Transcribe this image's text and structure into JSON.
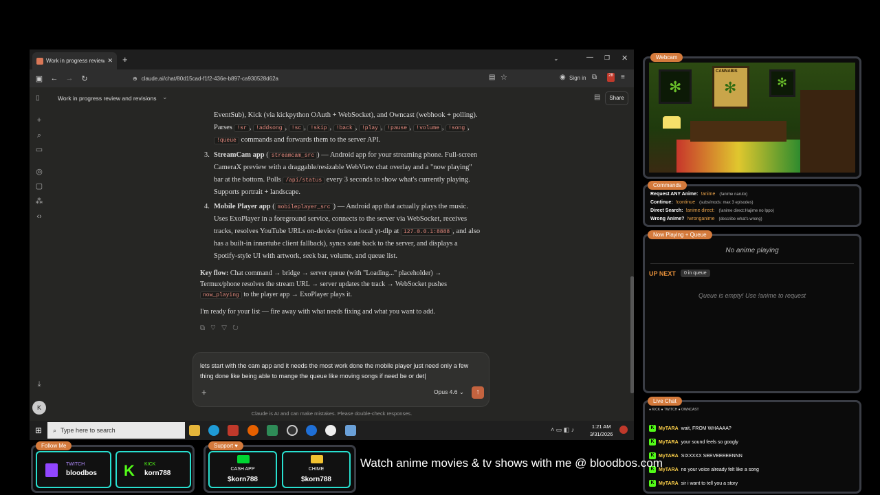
{
  "browser": {
    "tab_title": "Work in progress review and re",
    "url": "claude.ai/chat/80d15cad-f1f2-436e-b897-ca930528d62a",
    "sign_in": "Sign in",
    "ext_badge": "28"
  },
  "app": {
    "conversation_title": "Work in progress review and revisions",
    "share_label": "Share",
    "model": "Opus 4.6",
    "disclaimer": "Claude is AI and can make mistakes. Please double-check responses.",
    "composer_text": "lets start with the cam app and it needs the most work done the mobile player just need only a few thing done like being able to mange the queue like moving songs if need be or det|"
  },
  "message": {
    "p1_a": "EventSub), Kick (via kickpython OAuth + WebSocket), and Owncast (webhook + polling). Parses",
    "p1_codes": [
      "!sr",
      "!addsong",
      "!sc",
      "!skip",
      "!back",
      "!play",
      "!pause",
      "!volume",
      "!song",
      "!queue"
    ],
    "p1_b": "commands and forwards them to the server API.",
    "item3_num": "3.",
    "item3_title": "StreamCam app",
    "item3_code": "streamcam_src",
    "item3_a": "— Android app for your streaming phone. Full-screen CameraX preview with a draggable/resizable WebView chat overlay and a \"now playing\" bar at the bottom. Polls",
    "item3_code2": "/api/status",
    "item3_b": "every 3 seconds to show what's currently playing. Supports portrait + landscape.",
    "item4_num": "4.",
    "item4_title": "Mobile Player app",
    "item4_code": "mobileplayer_src",
    "item4_a": "— Android app that actually plays the music. Uses ExoPlayer in a foreground service, connects to the server via WebSocket, receives tracks, resolves YouTube URLs on-device (tries a local yt-dlp at",
    "item4_code2": "127.0.0.1:8888",
    "item4_b": ", and also has a built-in innertube client fallback), syncs state back to the server, and displays a Spotify-style UI with artwork, seek bar, volume, and queue list.",
    "keyflow_label": "Key flow:",
    "keyflow_a": "Chat command → bridge → server queue (with \"Loading...\" placeholder) → Termux/phone resolves the stream URL → server updates the track → WebSocket pushes",
    "keyflow_code": "now_playing",
    "keyflow_b": "to the player app → ExoPlayer plays it.",
    "closing": "I'm ready for your list — fire away with what needs fixing and what you want to add."
  },
  "taskbar": {
    "search_placeholder": "Type here to search",
    "time": "1:21 AM",
    "date": "3/31/2026"
  },
  "overlay": {
    "webcam_tag": "Webcam",
    "scene_sign": "CANNABIS",
    "commands_tag": "Commands",
    "commands": [
      {
        "label": "Request ANY Anime:",
        "cmd": "!anime",
        "desc": "(!anime naruto)"
      },
      {
        "label": "Continue:",
        "cmd": "!continue",
        "desc": "(subs/mods: max 3 episodes)"
      },
      {
        "label": "Direct Search:",
        "cmd": "!anime direct:",
        "desc": "(!anime direct:Hajime no Ippo)"
      },
      {
        "label": "Wrong Anime?",
        "cmd": "!wronganime",
        "desc": "(describe what's wrong)"
      }
    ],
    "now_tag": "Now Playing + Queue",
    "no_anime": "No anime playing",
    "up_next": "UP NEXT",
    "queue_count": "0 in queue",
    "queue_empty": "Queue is empty! Use !anime to request",
    "chat_tag": "Live Chat",
    "chat_platforms": "● KICK  ● TWITCH  ● OWNCAST",
    "chat": [
      {
        "user": "MyTARA",
        "msg": "wait, FROM WHAAAA?"
      },
      {
        "user": "MyTARA",
        "msg": "your sound feels so googly"
      },
      {
        "user": "MyTARA",
        "msg": "SIXXXXX SEEVEEEEENNN"
      },
      {
        "user": "MyTARA",
        "msg": "no your voice already felt like a song"
      },
      {
        "user": "MyTARA",
        "msg": "sir i want to tell you a story"
      }
    ],
    "follow_tag": "Follow Me",
    "twitch_label": "TWITCH",
    "twitch_user": "bloodbos",
    "kick_label": "KICK",
    "kick_user": "korn788",
    "support_tag": "Support ♥",
    "cashapp_label": "CASH APP",
    "cashapp_user": "$korn788",
    "chime_label": "CHIME",
    "chime_user": "$korn788",
    "ticker": "Watch anime movies & tv shows with me @ bloodbos.com"
  },
  "colors": {
    "accent": "#d97757",
    "overlay_tag": "#d47a3c",
    "card_border": "#28e0d0",
    "kick_green": "#53fc18"
  }
}
